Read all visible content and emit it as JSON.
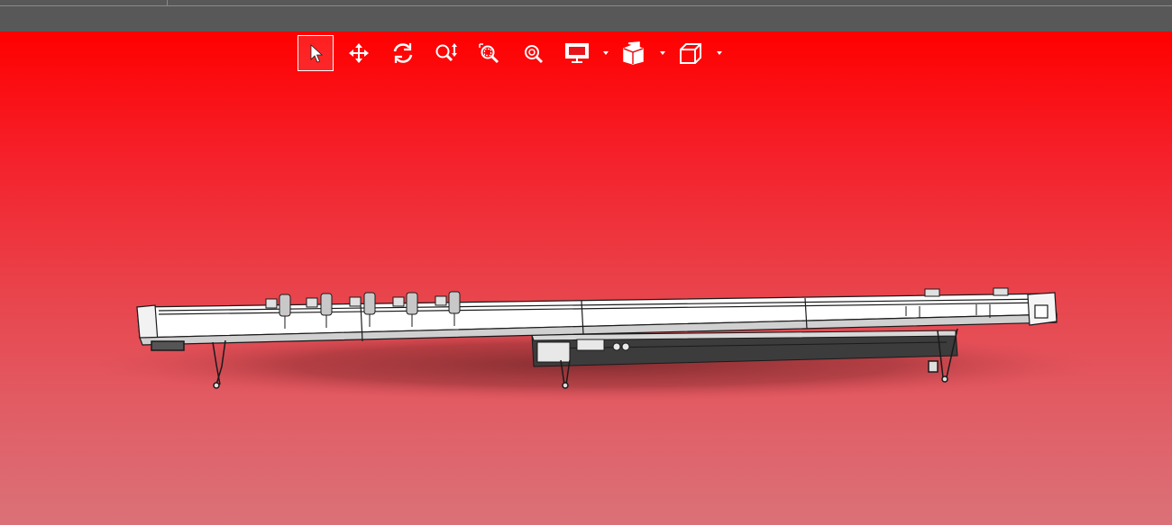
{
  "window": {
    "titlebar_color": "#585858"
  },
  "viewport": {
    "background_top": "#ff0000",
    "background_bottom": "#db7178",
    "model_color": "#ffffff",
    "model_outline": "#1a1a1a"
  },
  "toolbar": {
    "tools": [
      {
        "name": "select",
        "icon": "pointer-arrow-icon",
        "active": true
      },
      {
        "name": "pan",
        "icon": "move-arrows-icon",
        "active": false
      },
      {
        "name": "rotate",
        "icon": "rotate-icon",
        "active": false
      },
      {
        "name": "zoom",
        "icon": "zoom-in-out-icon",
        "active": false
      },
      {
        "name": "zoom-window",
        "icon": "zoom-window-icon",
        "active": false
      },
      {
        "name": "zoom-fit",
        "icon": "zoom-fit-icon",
        "active": false
      },
      {
        "name": "display-mode",
        "icon": "monitor-icon",
        "active": false,
        "dropdown": true
      },
      {
        "name": "section-view",
        "icon": "section-box-icon",
        "active": false,
        "dropdown": true
      },
      {
        "name": "view-orientation",
        "icon": "cube-icon",
        "active": false,
        "dropdown": true
      }
    ]
  }
}
